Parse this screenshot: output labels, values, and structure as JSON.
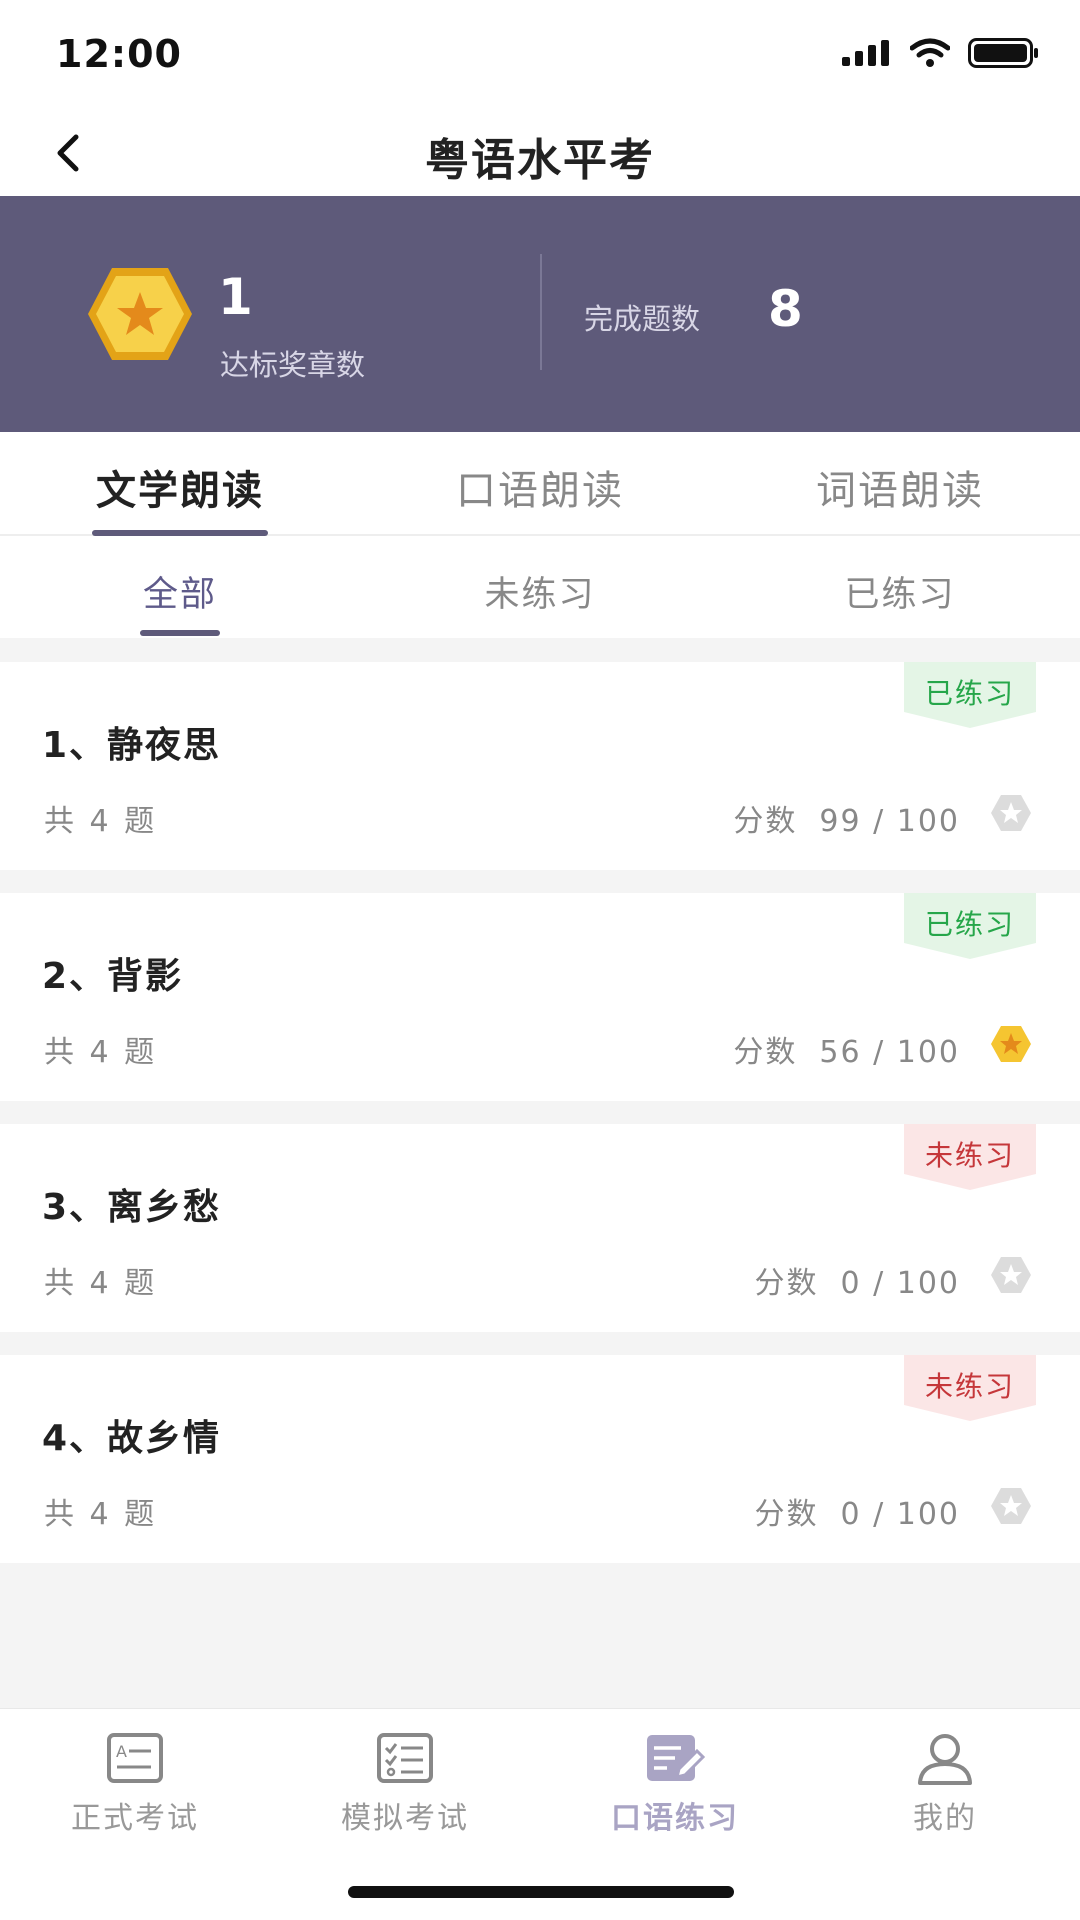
{
  "status": {
    "time": "12:00"
  },
  "nav": {
    "title": "粤语水平考"
  },
  "stats": {
    "medal_count": "1",
    "medal_label": "达标奖章数",
    "done_label": "完成题数",
    "done_count": "8"
  },
  "main_tabs": [
    {
      "label": "文学朗读",
      "active": true
    },
    {
      "label": "口语朗读",
      "active": false
    },
    {
      "label": "词语朗读",
      "active": false
    }
  ],
  "sub_tabs": [
    {
      "label": "全部",
      "active": true
    },
    {
      "label": "未练习",
      "active": false
    },
    {
      "label": "已练习",
      "active": false
    }
  ],
  "items": [
    {
      "title": "1、静夜思",
      "count": "共 4 题",
      "score_label": "分数",
      "score": "99 / 100",
      "status": "已练习",
      "star": "star-outline-icon"
    },
    {
      "title": "2、背影",
      "count": "共 4 题",
      "score_label": "分数",
      "score": "56 / 100",
      "status": "已练习",
      "star": "star-gold-icon"
    },
    {
      "title": "3、离乡愁",
      "count": "共 4 题",
      "score_label": "分数",
      "score": "0 / 100",
      "status": "未练习",
      "star": "star-outline-icon"
    },
    {
      "title": "4、故乡情",
      "count": "共 4 题",
      "score_label": "分数",
      "score": "0 / 100",
      "status": "未练习",
      "star": "star-outline-icon"
    }
  ],
  "tabbar": [
    {
      "label": "正式考试",
      "icon": "exam-doc-icon",
      "active": false
    },
    {
      "label": "模拟考试",
      "icon": "checklist-icon",
      "active": false
    },
    {
      "label": "口语练习",
      "icon": "edit-note-icon",
      "active": true
    },
    {
      "label": "我的",
      "icon": "user-icon",
      "active": false
    }
  ],
  "colors": {
    "banner": "#5e5a7a",
    "accent": "#5e5a8a",
    "tag_done": "#26a64a",
    "tag_todo": "#c5373a",
    "medal": "#f5c531"
  }
}
